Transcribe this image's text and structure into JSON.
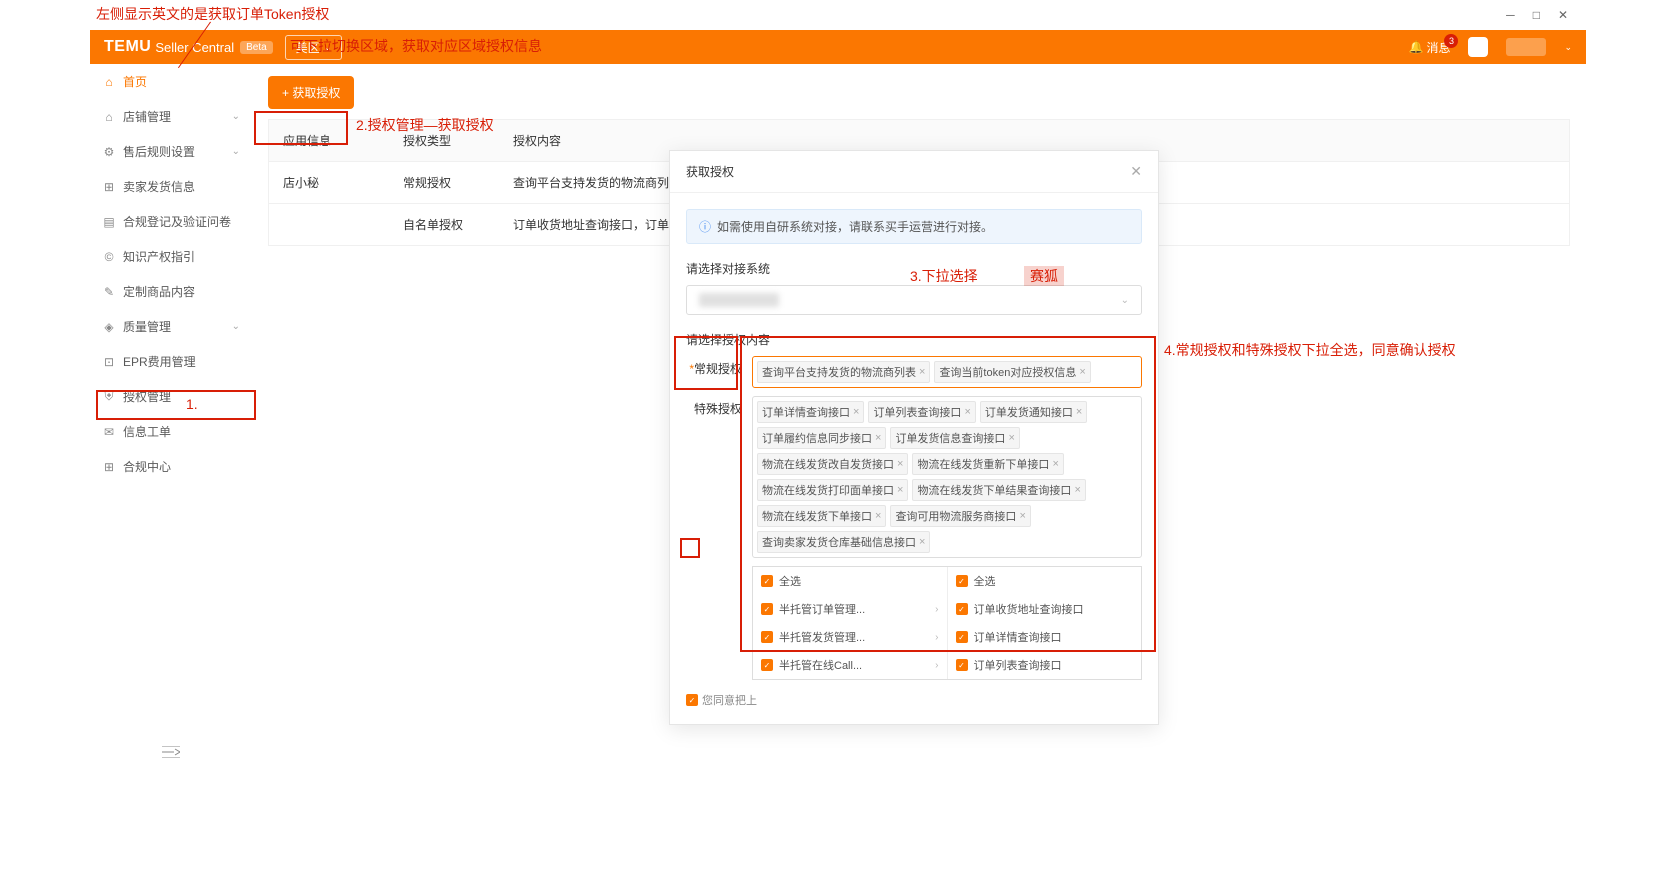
{
  "annotations": {
    "a1": "左侧显示英文的是获取订单Token授权",
    "a2": "可下拉切换区域，获取对应区域授权信息",
    "a3": "2.授权管理—获取授权",
    "a4": "1.",
    "a5": "3.下拉选择",
    "a5b": "赛狐",
    "a6": "4.常规授权和特殊授权下拉全选，同意确认授权"
  },
  "colors": {
    "brand": "#fb7701",
    "annot": "#d81e06"
  },
  "header": {
    "logo": "TEMU",
    "logo_sub": "Seller Central",
    "beta": "Beta",
    "region": "美区",
    "notif": "消息",
    "notif_count": "3"
  },
  "sidebar": {
    "items": [
      {
        "label": "首页",
        "icon": "home",
        "active": true,
        "expandable": false
      },
      {
        "label": "店铺管理",
        "icon": "shop",
        "expandable": true
      },
      {
        "label": "售后规则设置",
        "icon": "settings",
        "expandable": true
      },
      {
        "label": "卖家发货信息",
        "icon": "truck"
      },
      {
        "label": "合规登记及验证问卷",
        "icon": "doc"
      },
      {
        "label": "知识产权指引",
        "icon": "ip"
      },
      {
        "label": "定制商品内容",
        "icon": "custom"
      },
      {
        "label": "质量管理",
        "icon": "quality",
        "expandable": true
      },
      {
        "label": "EPR费用管理",
        "icon": "epr"
      },
      {
        "label": "授权管理",
        "icon": "shield",
        "highlighted": true
      },
      {
        "label": "信息工单",
        "icon": "ticket"
      },
      {
        "label": "合规中心",
        "icon": "comp"
      }
    ]
  },
  "main": {
    "get_auth_btn": "+ 获取授权",
    "table": {
      "headers": [
        "应用信息",
        "授权类型",
        "授权内容"
      ],
      "rows": [
        {
          "app": "店小秘",
          "type": "常规授权",
          "content": "查询平台支持发货的物流商列表"
        },
        {
          "app": "",
          "type": "自名单授权",
          "content": "订单收货地址查询接口，订单详情查询接口，"
        }
      ]
    }
  },
  "modal": {
    "title": "获取授权",
    "alert": "如需使用自研系统对接，请联系买手运营进行对接。",
    "select_system_label": "请选择对接系统",
    "select_system_placeholder": " ",
    "select_content_label": "请选择授权内容",
    "regular_label": "常规授权",
    "special_label": "特殊授权",
    "regular_tags": [
      "查询平台支持发货的物流商列表",
      "查询当前token对应授权信息"
    ],
    "special_tags": [
      "订单详情查询接口",
      "订单列表查询接口",
      "订单发货通知接口",
      "订单履约信息同步接口",
      "订单发货信息查询接口",
      "物流在线发货改自发货接口",
      "物流在线发货重新下单接口",
      "物流在线发货打印面单接口",
      "物流在线发货下单结果查询接口",
      "物流在线发货下单接口",
      "查询可用物流服务商接口",
      "查询卖家发货仓库基础信息接口"
    ],
    "dd": {
      "select_all": "全选",
      "left": [
        "半托管订单管理...",
        "半托管发货管理...",
        "半托管在线Call..."
      ],
      "right": [
        "订单收货地址查询接口",
        "订单详情查询接口",
        "订单列表查询接口"
      ]
    },
    "agree": "您同意把上"
  }
}
